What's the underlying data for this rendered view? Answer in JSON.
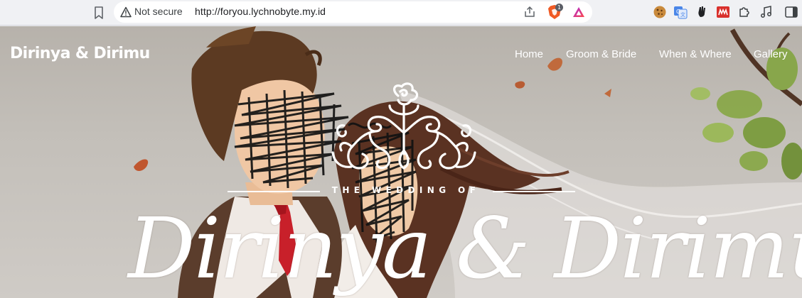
{
  "browser": {
    "security_label": "Not secure",
    "url": "http://foryou.lychnobyte.my.id",
    "brave_shield_count": "1",
    "icons": [
      "bookmark-icon",
      "warning-triangle-icon",
      "share-icon",
      "brave-shield-icon",
      "brave-rewards-icon",
      "cookie-extension-icon",
      "translate-extension-icon",
      "hand-extension-icon",
      "media-extension-icon",
      "puzzle-extensions-icon",
      "music-icon",
      "side-panel-icon"
    ]
  },
  "site": {
    "brand": "Dirinya & Dirimu",
    "nav": [
      {
        "label": "Home"
      },
      {
        "label": "Groom & Bride"
      },
      {
        "label": "When & Where"
      },
      {
        "label": "Gallery"
      }
    ],
    "hero": {
      "subtitle": "THE WEDDING OF",
      "couple_names": "Dirinya & Dirimu"
    }
  },
  "colors": {
    "chrome_bg": "#f0f1f4",
    "hero_text": "#ffffff",
    "tie_red": "#c8202a",
    "brave_orange": "#f05a24"
  }
}
